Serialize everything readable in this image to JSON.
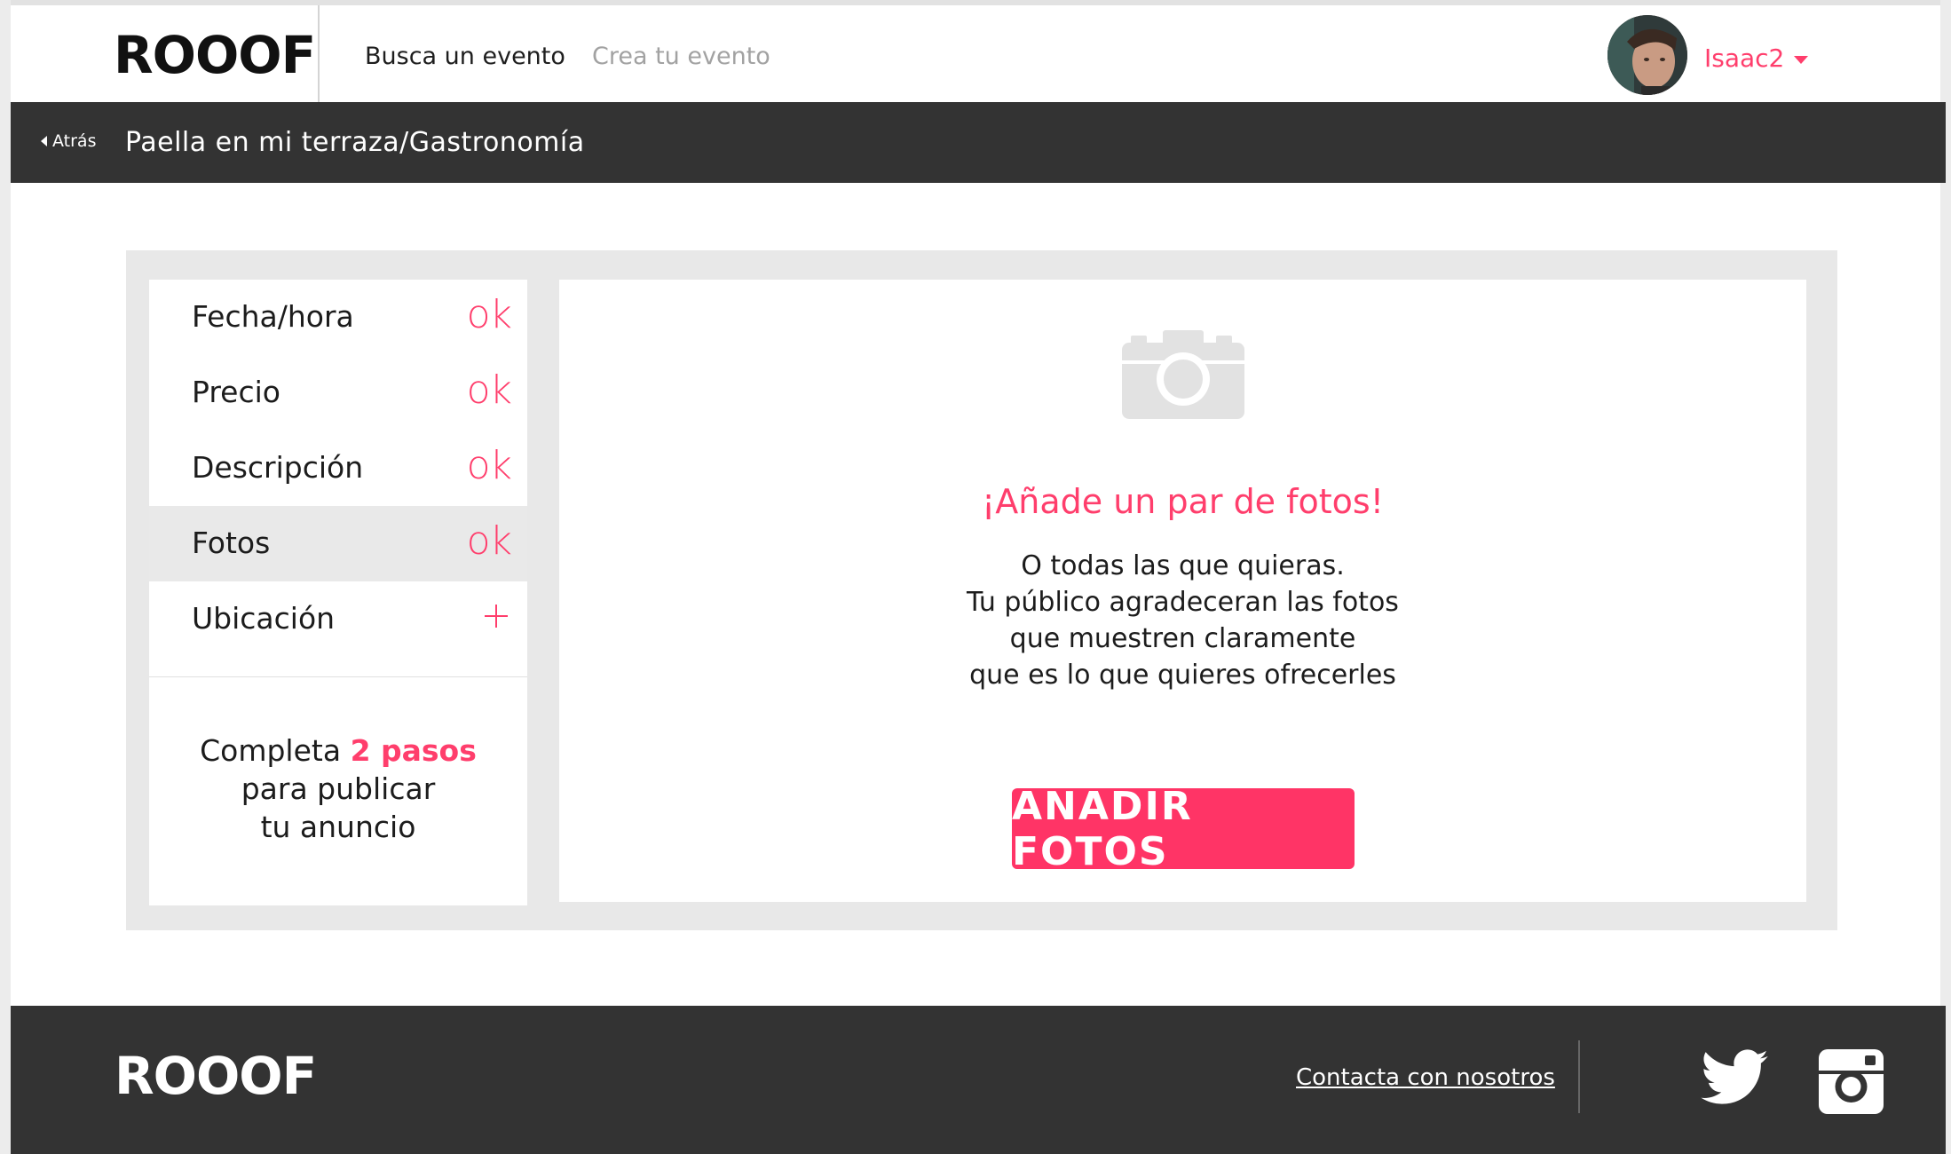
{
  "header": {
    "logo": "ROOOF",
    "nav": {
      "find_event": "Busca un evento",
      "create_event": "Crea tu evento"
    },
    "user": {
      "name": "Isaac2"
    }
  },
  "breadcrumb": {
    "back_label": "Atrás",
    "title": "Paella en mi terraza/Gastronomía"
  },
  "steps": [
    {
      "label": "Fecha/hora",
      "status": "ok"
    },
    {
      "label": "Precio",
      "status": "ok"
    },
    {
      "label": "Descripción",
      "status": "ok"
    },
    {
      "label": "Fotos",
      "status": "ok",
      "active": true
    },
    {
      "label": "Ubicación",
      "status": "+"
    }
  ],
  "progress": {
    "prefix": "Completa",
    "count": "2 pasos",
    "line2": "para publicar",
    "line3": "tu anuncio"
  },
  "photos": {
    "heading": "¡Añade un par de fotos!",
    "lines": [
      "O todas las que quieras.",
      "Tu público agradeceran las fotos",
      "que muestren claramente",
      "que es lo que quieres ofrecerles"
    ],
    "button": "AÑADIR FOTOS"
  },
  "footer": {
    "logo": "ROOOF",
    "contact": "Contacta con nosotros"
  },
  "colors": {
    "accent": "#ff3e6c",
    "dark_bar": "#333333",
    "panel_bg": "#e8e8e8"
  }
}
